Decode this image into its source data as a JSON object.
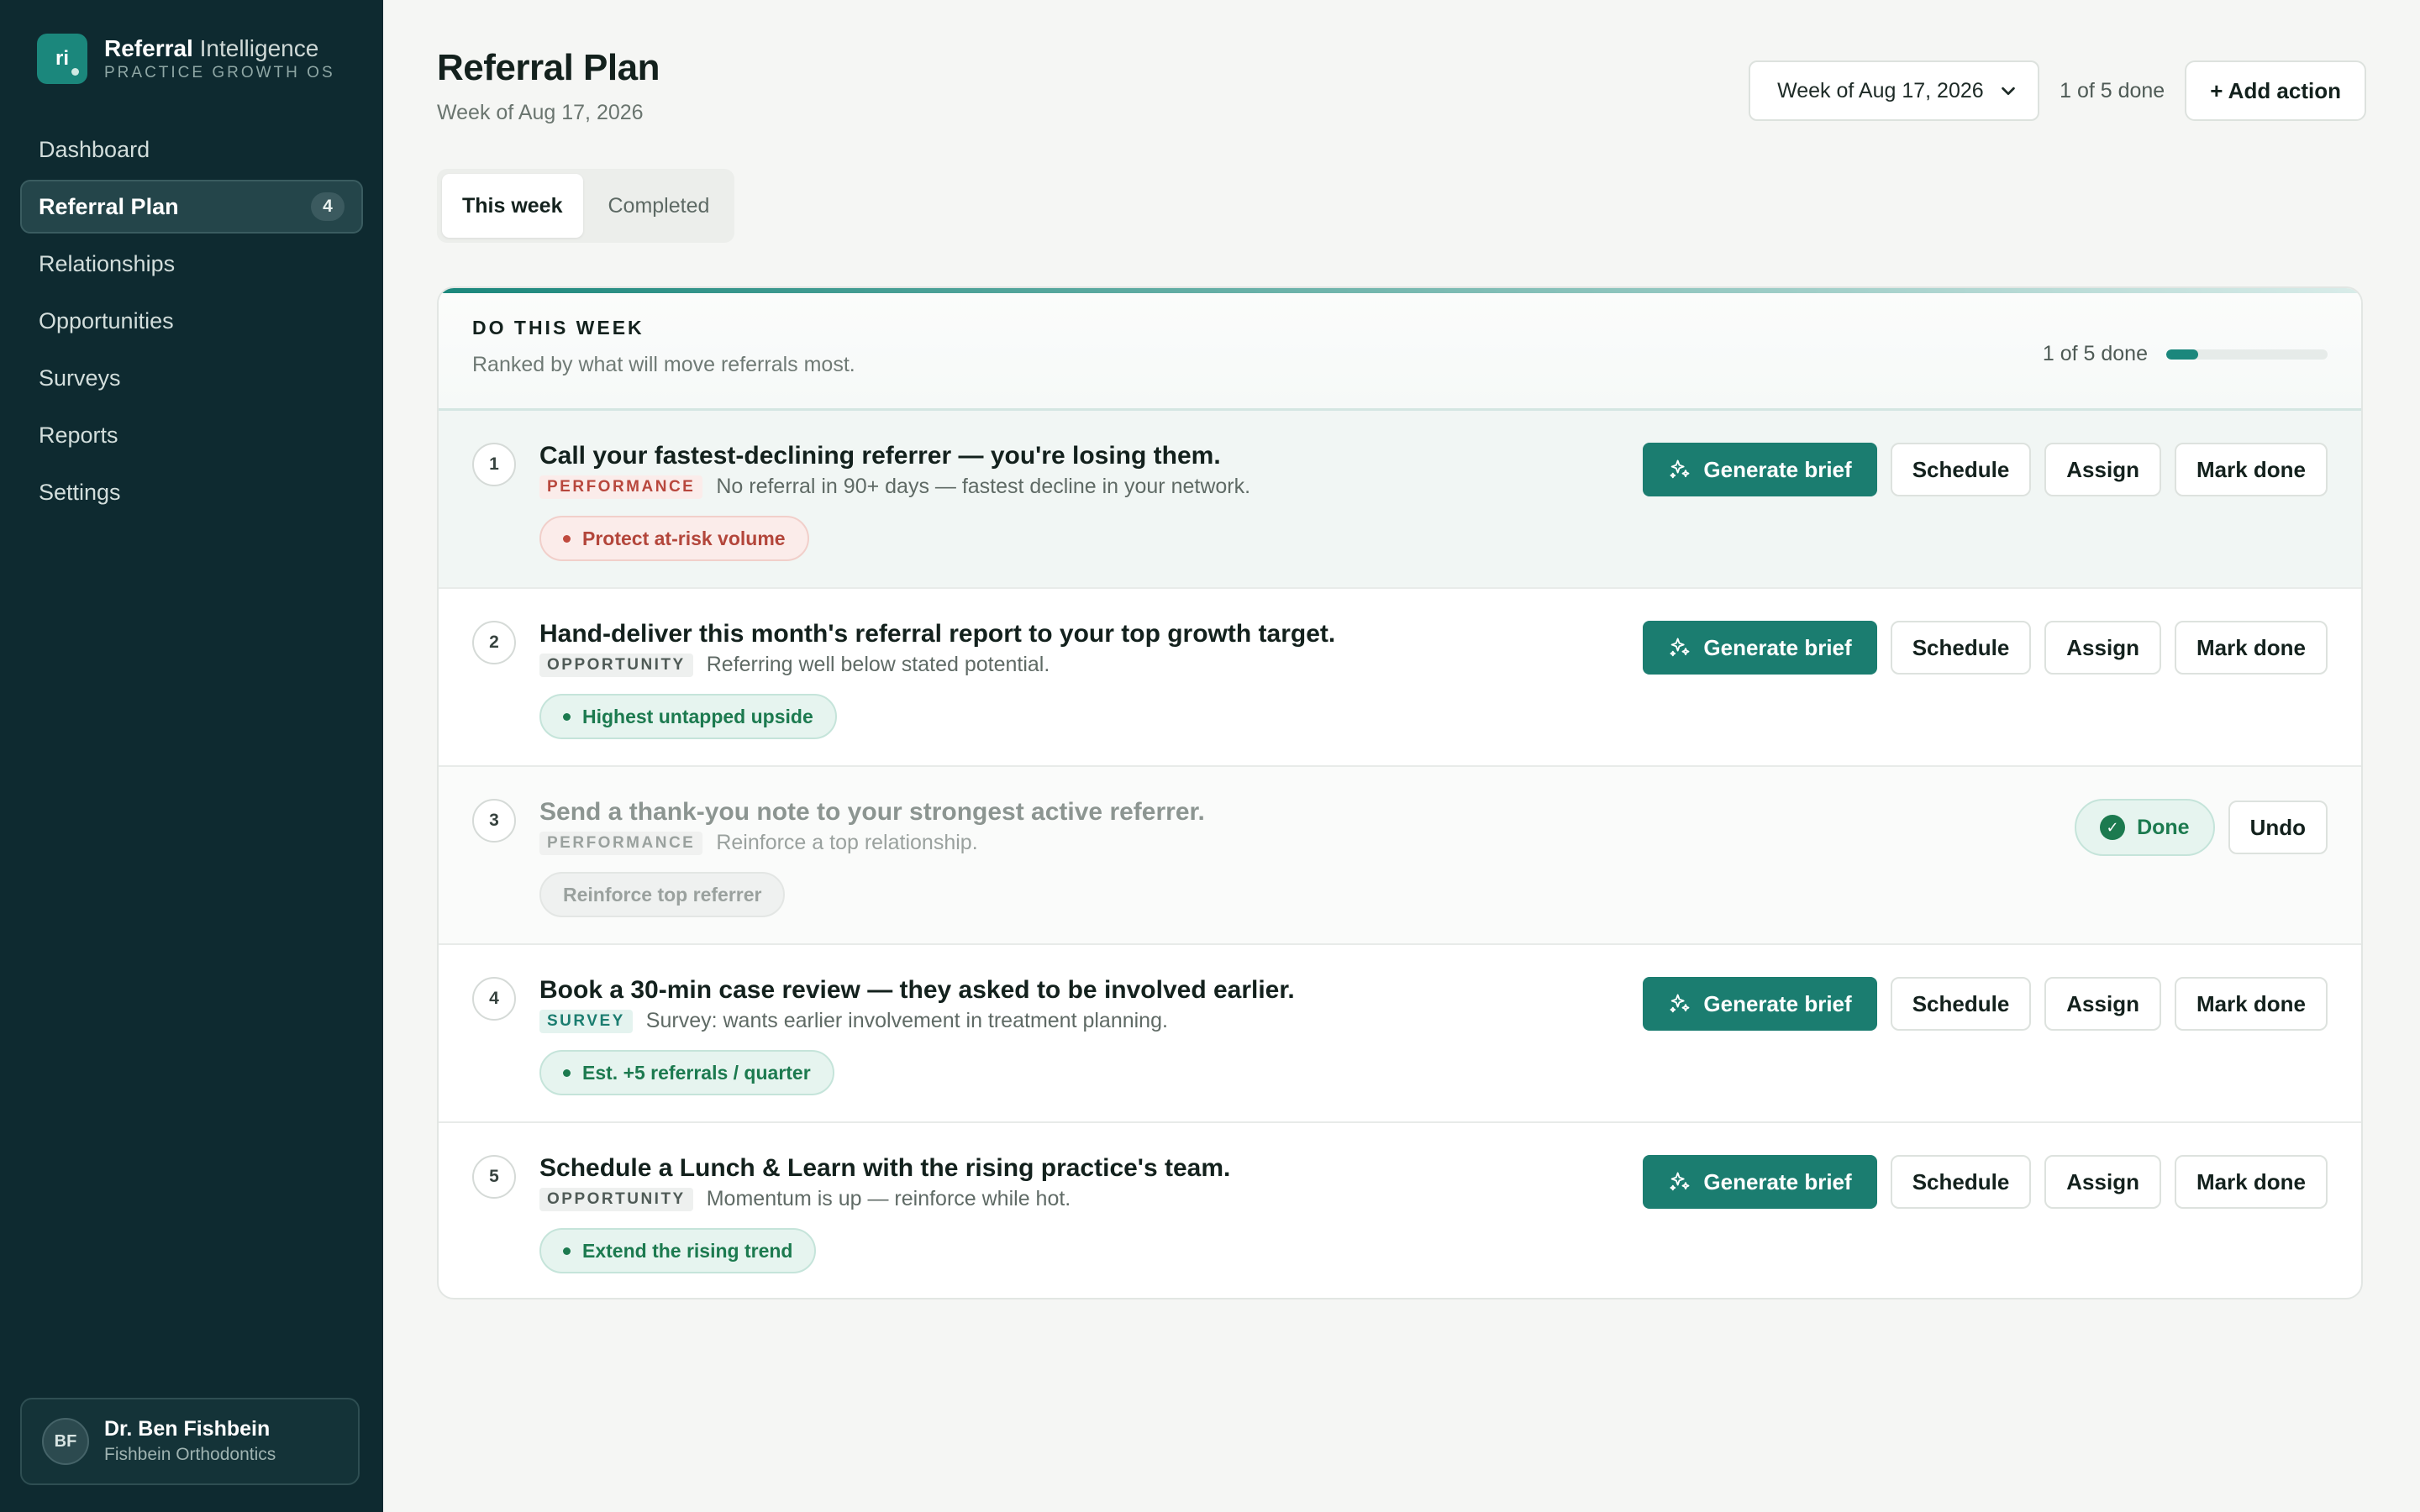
{
  "brand": {
    "name_bold": "Referral",
    "name_rest": "Intelligence",
    "tagline": "PRACTICE GROWTH OS",
    "logo_text": "ri"
  },
  "sidebar": {
    "items": [
      {
        "label": "Dashboard"
      },
      {
        "label": "Referral Plan",
        "badge": "4",
        "active": true
      },
      {
        "label": "Relationships"
      },
      {
        "label": "Opportunities"
      },
      {
        "label": "Surveys"
      },
      {
        "label": "Reports"
      },
      {
        "label": "Settings"
      }
    ]
  },
  "user": {
    "initials": "BF",
    "name": "Dr. Ben Fishbein",
    "org": "Fishbein Orthodontics"
  },
  "header": {
    "title": "Referral Plan",
    "subtitle": "Week of Aug 17, 2026",
    "week_select": "Week of Aug 17, 2026",
    "done_count": "1 of 5 done",
    "add_action": "+ Add action"
  },
  "tabs": [
    {
      "label": "This week",
      "active": true
    },
    {
      "label": "Completed"
    }
  ],
  "card": {
    "title": "DO THIS WEEK",
    "subtitle": "Ranked by what will move referrals most.",
    "progress_text": "1 of 5 done",
    "progress": 0.2
  },
  "buttons": {
    "generate": "Generate brief",
    "schedule": "Schedule",
    "assign": "Assign",
    "mark_done": "Mark done",
    "done": "Done",
    "undo": "Undo"
  },
  "actions": [
    {
      "num": "1",
      "title": "Call your fastest-declining referrer — you're losing them.",
      "tag": "PERFORMANCE",
      "detail": "No referral in 90+ days — fastest decline in your network.",
      "pill": "Protect at-risk volume",
      "status": "open"
    },
    {
      "num": "2",
      "title": "Hand-deliver this month's referral report to your top growth target.",
      "tag": "OPPORTUNITY",
      "detail": "Referring well below stated potential.",
      "pill": "Highest untapped upside",
      "status": "open"
    },
    {
      "num": "3",
      "title": "Send a thank-you note to your strongest active referrer.",
      "tag": "PERFORMANCE",
      "detail": "Reinforce a top relationship.",
      "pill": "Reinforce top referrer",
      "status": "done"
    },
    {
      "num": "4",
      "title": "Book a 30-min case review — they asked to be involved earlier.",
      "tag": "SURVEY",
      "detail": "Survey: wants earlier involvement in treatment planning.",
      "pill": "Est. +5 referrals / quarter",
      "status": "open"
    },
    {
      "num": "5",
      "title": "Schedule a Lunch & Learn with the rising practice's team.",
      "tag": "OPPORTUNITY",
      "detail": "Momentum is up — reinforce while hot.",
      "pill": "Extend the rising trend",
      "status": "open"
    }
  ],
  "colors": {
    "sidebar": "#0e2a30",
    "accent": "#1b7d70",
    "danger": "#b8473d",
    "success": "#1c7a4f"
  }
}
